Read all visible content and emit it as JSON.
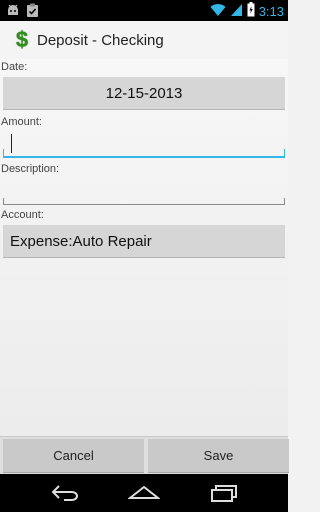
{
  "status_bar": {
    "time": "3:13",
    "left_icons": [
      "android-debug-icon",
      "clipboard-icon"
    ],
    "right_icons": [
      "wifi-icon",
      "signal-icon",
      "battery-icon"
    ]
  },
  "action_bar": {
    "title": "Deposit - Checking",
    "icon": "dollar-icon",
    "icon_glyph": "$"
  },
  "form": {
    "date_label": "Date:",
    "date_value": "12-15-2013",
    "amount_label": "Amount:",
    "amount_value": "",
    "description_label": "Description:",
    "description_value": "",
    "account_label": "Account:",
    "account_value": "Expense:Auto Repair"
  },
  "buttons": {
    "cancel": "Cancel",
    "save": "Save"
  },
  "nav_bar": {
    "icons": [
      "back-icon",
      "home-icon",
      "recent-apps-icon"
    ]
  },
  "colors": {
    "accent": "#33b5e5",
    "dollar_green": "#2f8f1a"
  }
}
